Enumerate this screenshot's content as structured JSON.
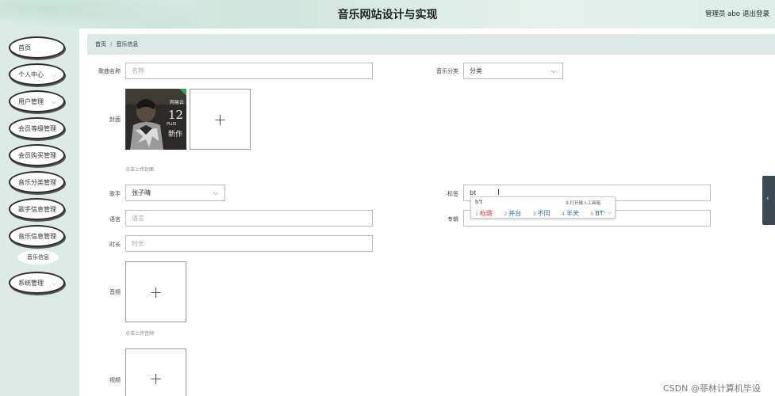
{
  "header": {
    "title": "音乐网站设计与实现",
    "user": "管理员 abo",
    "logout": "退出登录"
  },
  "sidebar": {
    "items": [
      {
        "label": "首页",
        "expandable": false
      },
      {
        "label": "个人中心",
        "expandable": true
      },
      {
        "label": "用户管理",
        "expandable": true
      },
      {
        "label": "会员等级管理",
        "expandable": false
      },
      {
        "label": "会员购买管理",
        "expandable": false
      },
      {
        "label": "音乐分类管理",
        "expandable": false
      },
      {
        "label": "歌手信息管理",
        "expandable": false
      },
      {
        "label": "音乐信息管理",
        "expandable": false
      },
      {
        "label": "系统管理",
        "expandable": true
      }
    ],
    "sub_item": "音乐信息"
  },
  "breadcrumb": {
    "home": "首页",
    "separator": "/",
    "current": "音乐信息"
  },
  "form": {
    "song_name": {
      "label": "歌曲名称",
      "placeholder": "名称"
    },
    "category": {
      "label": "音乐分类",
      "value": "分类"
    },
    "cover": {
      "label": "封面",
      "hint": "点击上传封面",
      "image_title": "周杰伦",
      "image_text": "PLUS 12 新作"
    },
    "singer": {
      "label": "歌手",
      "value": "张子晴"
    },
    "tag": {
      "label": "标签",
      "value": "bt"
    },
    "language": {
      "label": "语言",
      "placeholder": "语言"
    },
    "album": {
      "label": "专辑"
    },
    "duration": {
      "label": "时长",
      "placeholder": "时长"
    },
    "audio": {
      "label": "音频",
      "hint": "点击上传音频"
    },
    "video": {
      "label": "视频"
    }
  },
  "ime": {
    "composition": "b't",
    "tool_hint": "9.打开输入工具箱",
    "candidates": [
      "标题",
      "并台",
      "不同",
      "半天",
      "BT"
    ]
  },
  "watermark": "CSDN @菲林计算机毕设"
}
